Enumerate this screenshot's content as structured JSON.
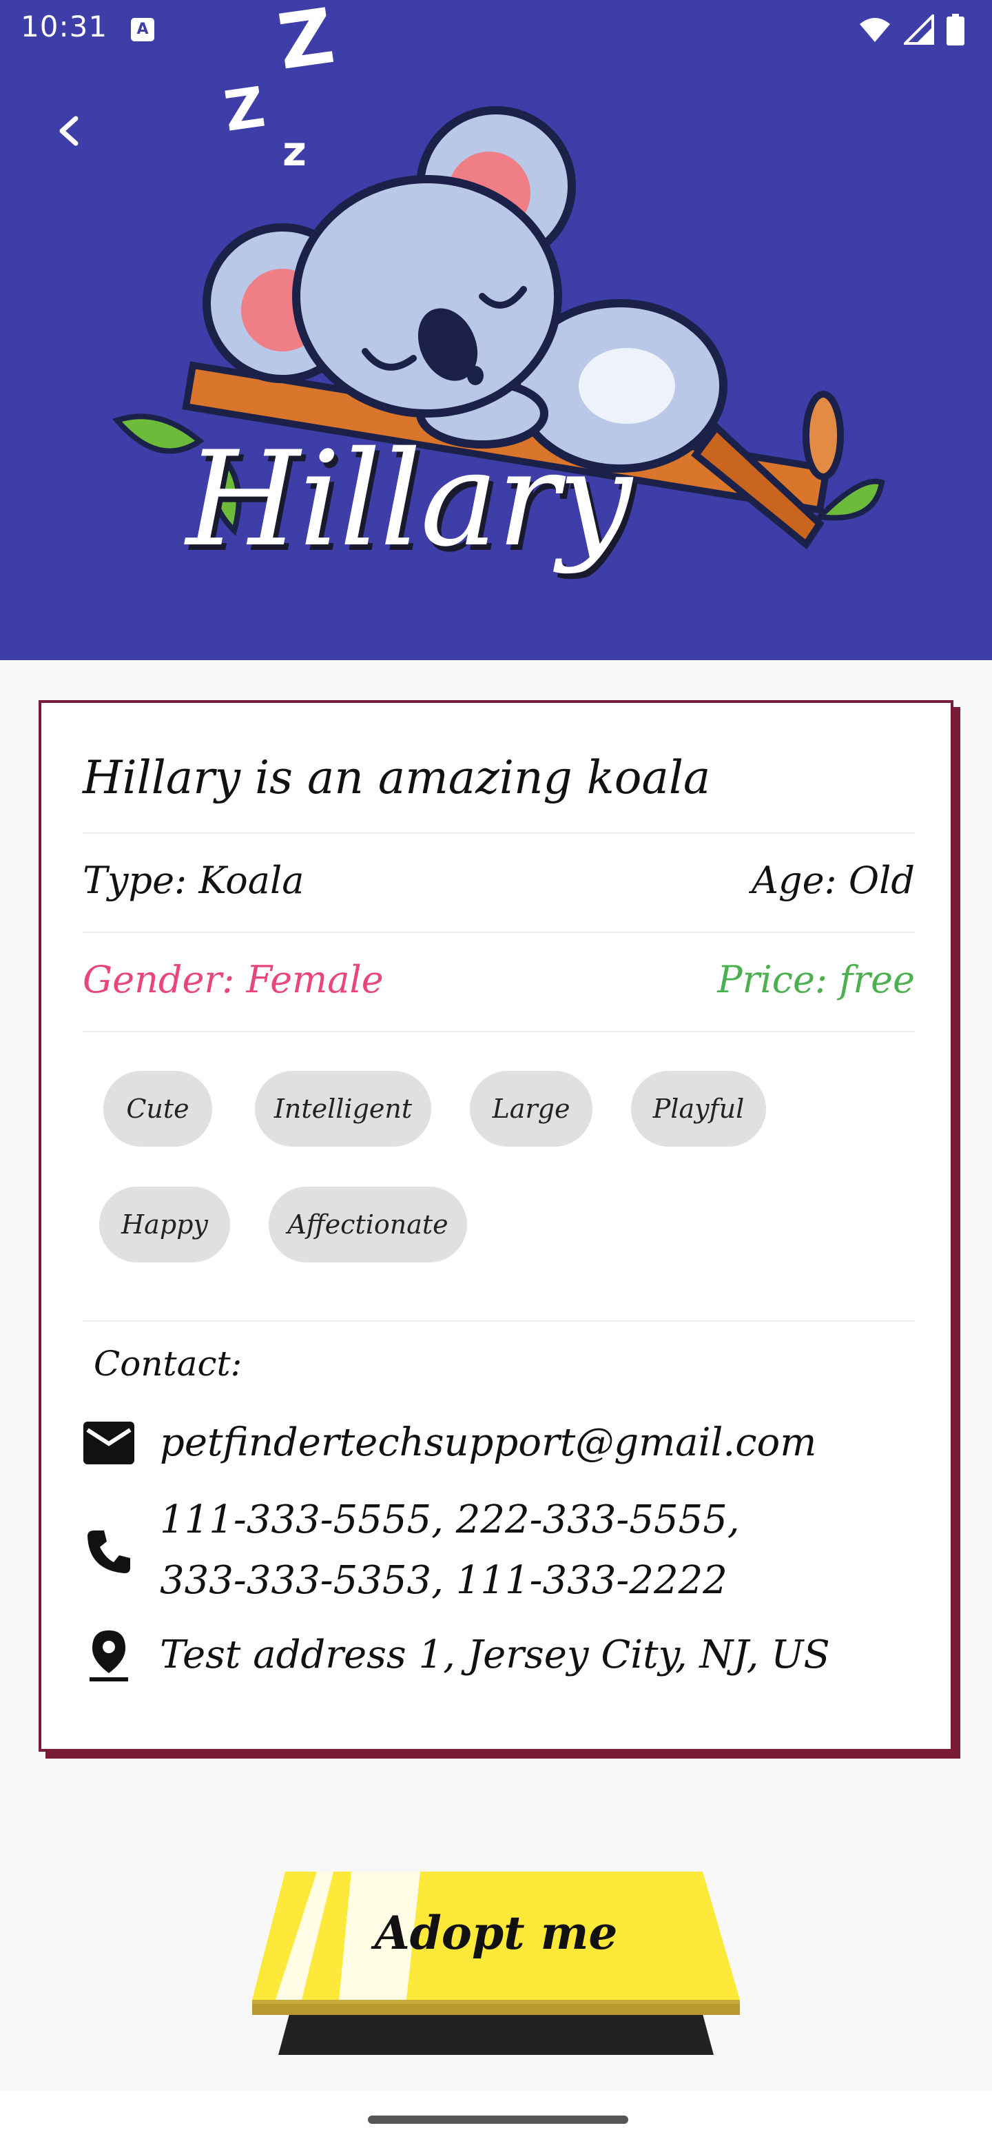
{
  "status_bar": {
    "time": "10:31",
    "app_icon_letter": "A"
  },
  "header": {
    "pet_name": "Hillary",
    "background_color": "#3e3ea8"
  },
  "details": {
    "headline": "Hillary is an amazing koala",
    "type": "Type: Koala",
    "age": "Age: Old",
    "gender": "Gender: Female",
    "price": "Price: free",
    "gender_color": "#e8467a",
    "price_color": "#4caf50",
    "tags": [
      "Cute",
      "Intelligent",
      "Large",
      "Playful",
      "Happy",
      "Affectionate"
    ]
  },
  "contact": {
    "title": "Contact:",
    "email": "petfindertechsupport@gmail.com",
    "phones_line1": "111-333-5555, 222-333-5555,",
    "phones_line2": "333-333-5353, 111-333-2222",
    "address": "Test address 1, Jersey City, NJ, US",
    "icons": [
      "mail-icon",
      "phone-icon",
      "location-pin-icon"
    ]
  },
  "action": {
    "adopt_label": "Adopt me",
    "button_color": "#fde93a"
  }
}
